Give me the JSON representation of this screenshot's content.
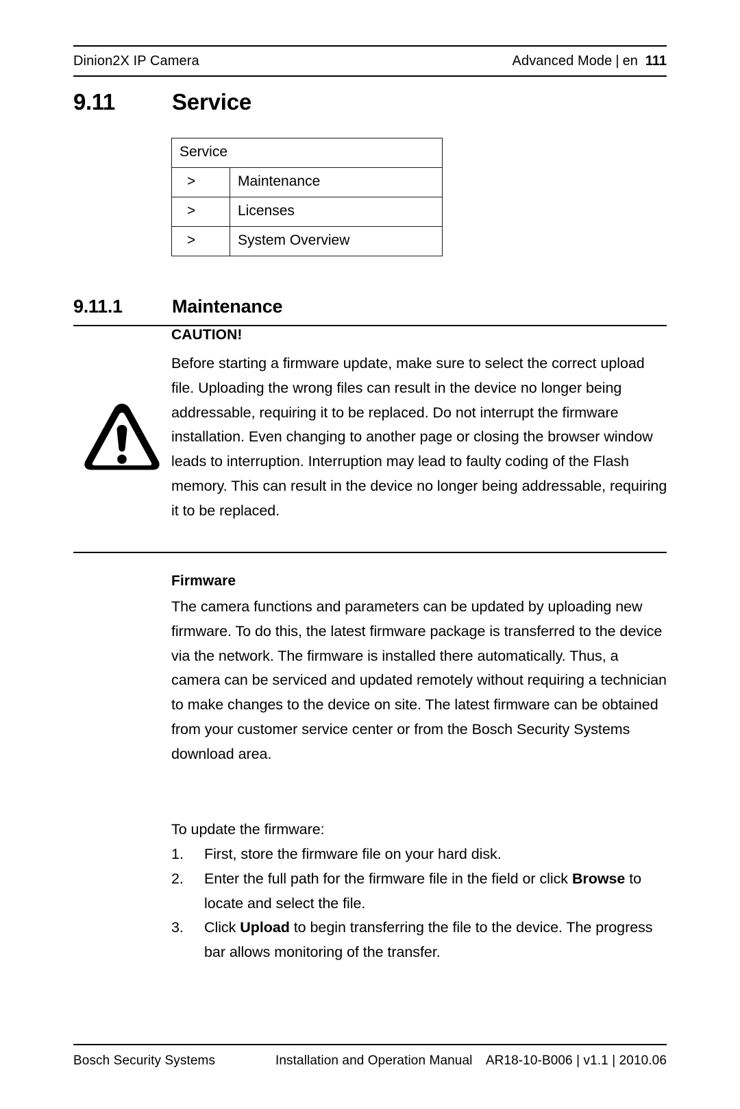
{
  "header": {
    "document_title": "Dinion2X IP Camera",
    "mode": "Advanced Mode",
    "separator": "|",
    "language": "en",
    "page_number": "111"
  },
  "section": {
    "number": "9.11",
    "title": "Service"
  },
  "nav_table": {
    "header_label": "Service",
    "rows": [
      {
        "arrow": ">",
        "label": "Maintenance"
      },
      {
        "arrow": ">",
        "label": "Licenses"
      },
      {
        "arrow": ">",
        "label": "System Overview"
      }
    ]
  },
  "subsection": {
    "number": "9.11.1",
    "title": "Maintenance"
  },
  "caution": {
    "icon": "warning-triangle-icon",
    "title": "CAUTION!",
    "text": "Before starting a firmware update, make sure to select the correct upload file. Uploading the wrong files can result in the device no longer being addressable, requiring it to be replaced. Do not interrupt the firmware installation. Even changing to another page or closing the browser window leads to interruption. Interruption may lead to faulty coding of the Flash memory. This can result in the device no longer being addressable, requiring it to be replaced."
  },
  "firmware": {
    "heading": "Firmware",
    "paragraph": "The camera functions and parameters can be updated by uploading new firmware. To do this, the latest firmware package is transferred to the device via the network. The firmware is installed there automatically. Thus, a camera can be serviced and updated remotely without requiring a technician to make changes to the device on site. The latest firmware can be obtained from your customer service center or from the Bosch Security Systems download area.",
    "update_lead": "To update the firmware:",
    "steps": [
      {
        "marker": "1.",
        "text_before": "First, store the firmware file on your hard disk.",
        "bold": "",
        "text_after": ""
      },
      {
        "marker": "2.",
        "text_before": "Enter the full path for the firmware file in the field or click ",
        "bold": "Browse",
        "text_after": " to locate and select the file."
      },
      {
        "marker": "3.",
        "text_before": "Click ",
        "bold": "Upload",
        "text_after": " to begin transferring the file to the device. The progress bar allows monitoring of the transfer."
      }
    ]
  },
  "footer": {
    "company": "Bosch Security Systems",
    "manual": "Installation and Operation Manual",
    "doc_id": "AR18-10-B006 | v1.1 | 2010.06"
  },
  "colors": {
    "text": "#000000",
    "rule": "#000000",
    "table_border": "#1a1a1a",
    "background": "#ffffff"
  }
}
